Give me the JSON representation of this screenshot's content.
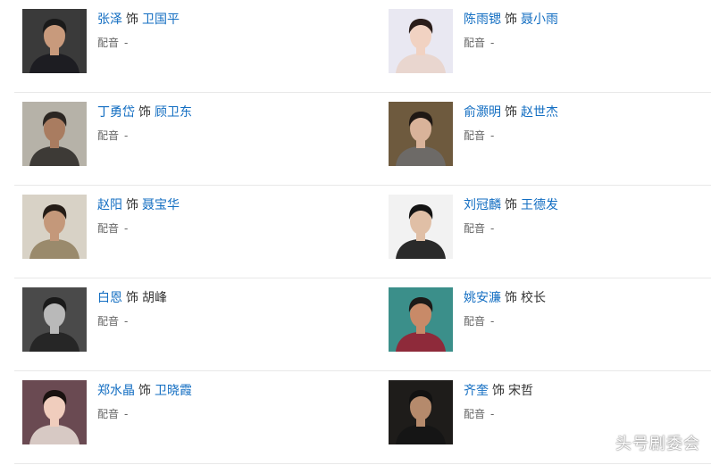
{
  "cast": [
    {
      "actor": "张泽",
      "verb": "饰",
      "role": "卫国平",
      "role_link": true,
      "dub_label": "配音",
      "dub_value": "-",
      "photo": {
        "bg": "#3a3a3a",
        "skin": "#c89a7c",
        "hair": "#1a1a1a",
        "cloth": "#1d1d22"
      }
    },
    {
      "actor": "陈雨锶",
      "verb": "饰",
      "role": "聂小雨",
      "role_link": true,
      "dub_label": "配音",
      "dub_value": "-",
      "photo": {
        "bg": "#e9e8f2",
        "skin": "#f1d2c2",
        "hair": "#2a1d1a",
        "cloth": "#e9d6cf"
      }
    },
    {
      "actor": "丁勇岱",
      "verb": "饰",
      "role": "顾卫东",
      "role_link": true,
      "dub_label": "配音",
      "dub_value": "-",
      "photo": {
        "bg": "#b6b2a8",
        "skin": "#a97c60",
        "hair": "#2b2622",
        "cloth": "#3d3a36"
      }
    },
    {
      "actor": "俞灏明",
      "verb": "饰",
      "role": "赵世杰",
      "role_link": true,
      "dub_label": "配音",
      "dub_value": "-",
      "photo": {
        "bg": "#6e5a3e",
        "skin": "#d9b39a",
        "hair": "#1f1814",
        "cloth": "#6d6a67"
      }
    },
    {
      "actor": "赵阳",
      "verb": "饰",
      "role": "聂宝华",
      "role_link": true,
      "dub_label": "配音",
      "dub_value": "-",
      "photo": {
        "bg": "#d8d2c6",
        "skin": "#c4987a",
        "hair": "#241c16",
        "cloth": "#9a8a6c"
      }
    },
    {
      "actor": "刘冠麟",
      "verb": "饰",
      "role": "王德发",
      "role_link": true,
      "dub_label": "配音",
      "dub_value": "-",
      "photo": {
        "bg": "#f2f2f2",
        "skin": "#e0bfa6",
        "hair": "#141414",
        "cloth": "#2a2a2a"
      }
    },
    {
      "actor": "白恩",
      "verb": "饰",
      "role": "胡峰",
      "role_link": false,
      "dub_label": "配音",
      "dub_value": "-",
      "photo": {
        "bg": "#4a4a4a",
        "skin": "#b9b9b9",
        "hair": "#1a1a1a",
        "cloth": "#262626"
      }
    },
    {
      "actor": "姚安濂",
      "verb": "饰",
      "role": "校长",
      "role_link": false,
      "dub_label": "配音",
      "dub_value": "-",
      "photo": {
        "bg": "#3b8f8a",
        "skin": "#c88a68",
        "hair": "#1c1a18",
        "cloth": "#8e2a3a"
      }
    },
    {
      "actor": "郑水晶",
      "verb": "饰",
      "role": "卫晓霞",
      "role_link": true,
      "dub_label": "配音",
      "dub_value": "-",
      "photo": {
        "bg": "#6a4a52",
        "skin": "#f0cdbd",
        "hair": "#1a1210",
        "cloth": "#d7c9c4"
      }
    },
    {
      "actor": "齐奎",
      "verb": "饰",
      "role": "宋哲",
      "role_link": false,
      "dub_label": "配音",
      "dub_value": "-",
      "photo": {
        "bg": "#1e1c1a",
        "skin": "#b58a6c",
        "hair": "#111111",
        "cloth": "#151515"
      }
    }
  ],
  "watermark": "头号剧委会"
}
